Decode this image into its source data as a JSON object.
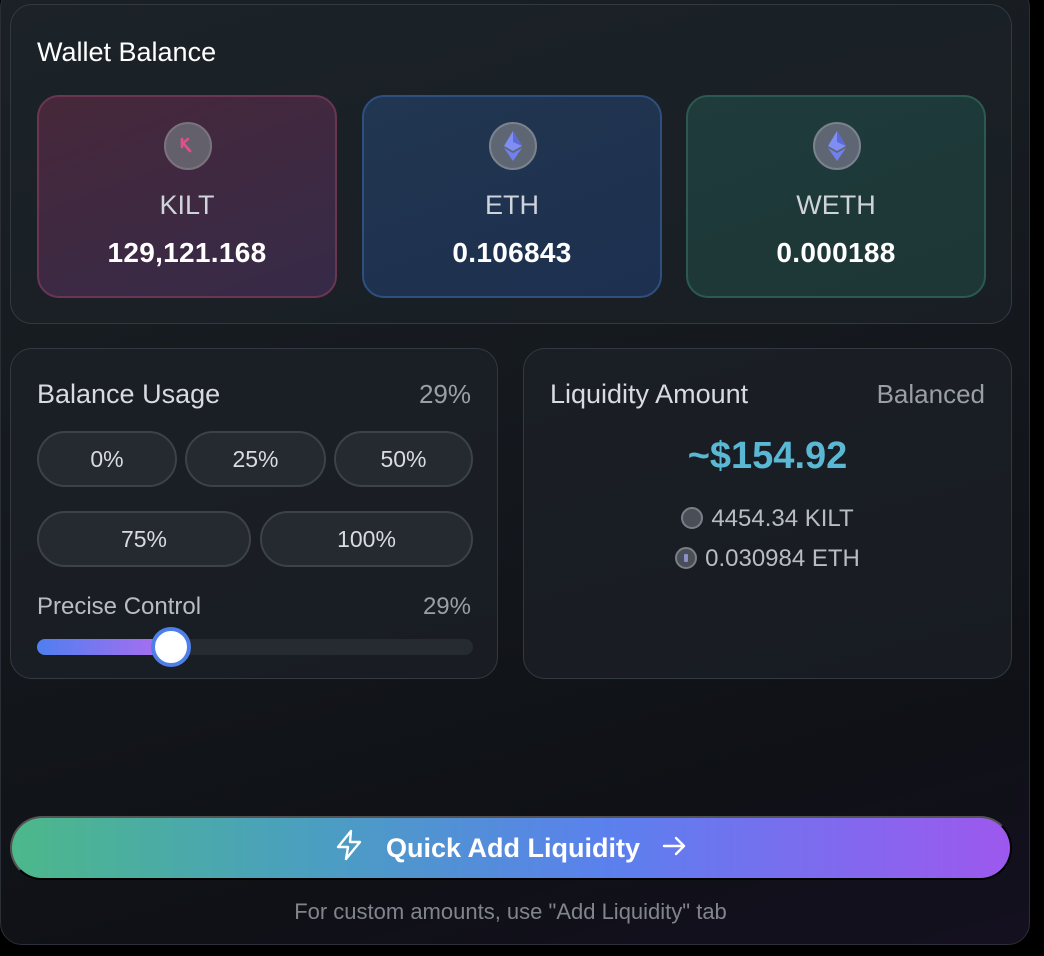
{
  "wallet": {
    "title": "Wallet Balance",
    "tokens": [
      {
        "symbol": "KILT",
        "balance": "129,121.168",
        "icon": "kilt-icon",
        "accent": "#e0508a"
      },
      {
        "symbol": "ETH",
        "balance": "0.106843",
        "icon": "ethereum-icon",
        "accent": "#6a7ff0"
      },
      {
        "symbol": "WETH",
        "balance": "0.000188",
        "icon": "ethereum-icon",
        "accent": "#6a7ff0"
      }
    ]
  },
  "usage": {
    "title": "Balance Usage",
    "percent_label": "29%",
    "presets": [
      "0%",
      "25%",
      "50%",
      "75%",
      "100%"
    ],
    "precise_label": "Precise Control",
    "precise_value": "29%",
    "slider_fraction": 0.29
  },
  "liquidity": {
    "title": "Liquidity Amount",
    "mode": "Balanced",
    "usd_amount": "~$154.92",
    "kilt_amount": "4454.34 KILT",
    "eth_amount": "0.030984 ETH"
  },
  "actions": {
    "quick_add_label": "Quick Add Liquidity",
    "hint": "For custom amounts, use \"Add Liquidity\" tab"
  },
  "colors": {
    "usd_amount": "#5bb8d4",
    "slider_start": "#4f7ff0",
    "slider_end": "#b06cf0"
  }
}
